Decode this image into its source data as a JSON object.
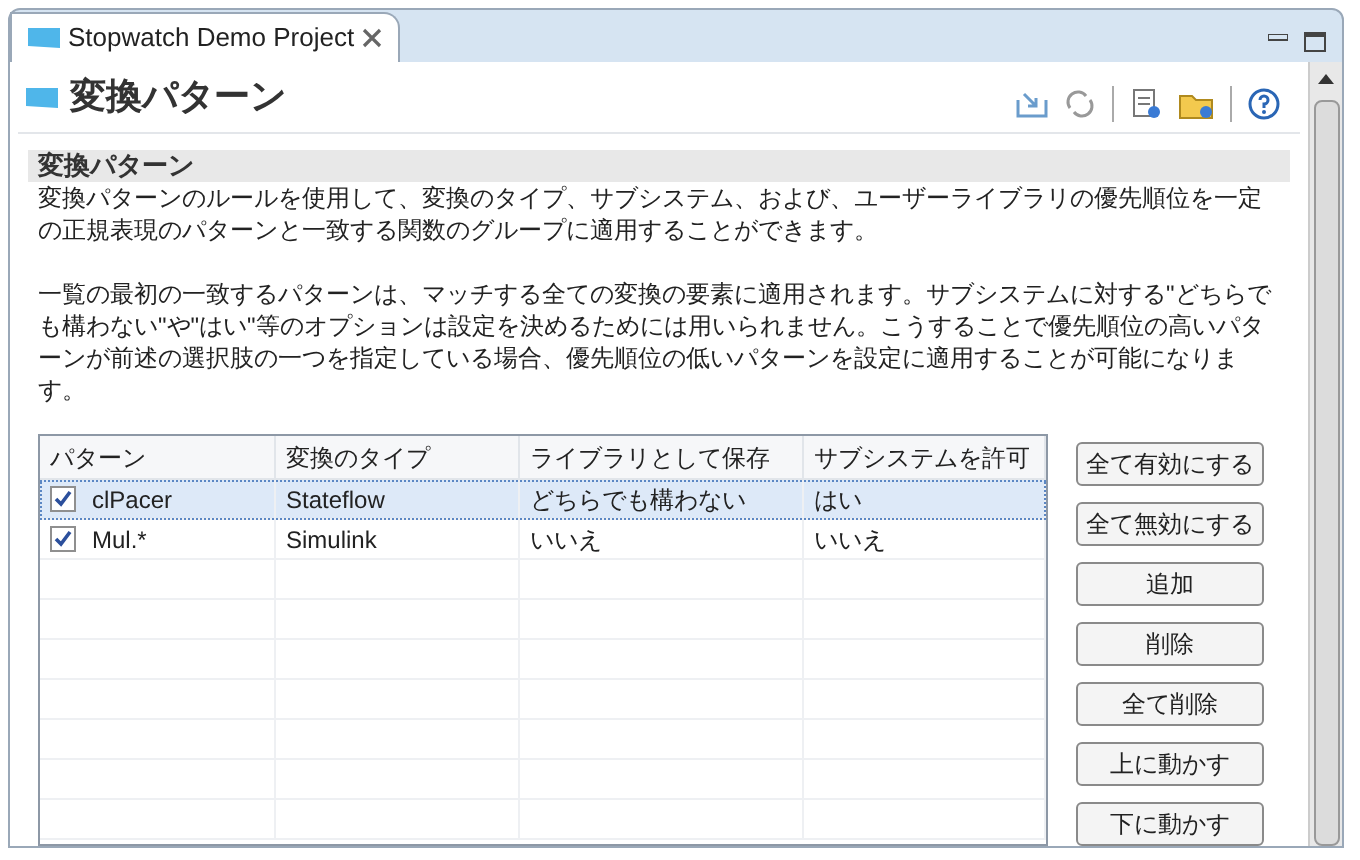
{
  "tab": {
    "label": "Stopwatch Demo Project",
    "selected": true
  },
  "page": {
    "title": "変換パターン"
  },
  "section": {
    "title": "変換パターン",
    "paragraphs": [
      "変換パターンのルールを使用して、変換のタイプ、サブシステム、および、ユーザーライブラリの優先順位を一定の正規表現のパターンと一致する関数のグループに適用することができます。",
      "一覧の最初の一致するパターンは、マッチする全ての変換の要素に適用されます。サブシステムに対する\"どちらでも構わない\"や\"はい\"等のオプションは設定を決めるためには用いられません。こうすることで優先順位の高いパターンが前述の選択肢の一つを指定している場合、優先順位の低いパターンを設定に適用することが可能になります。"
    ]
  },
  "table": {
    "columns": [
      "パターン",
      "変換のタイプ",
      "ライブラリとして保存",
      "サブシステムを許可"
    ],
    "rows": [
      {
        "checked": true,
        "selected": true,
        "cells": [
          "clPacer",
          "Stateflow",
          "どちらでも構わない",
          "はい"
        ]
      },
      {
        "checked": true,
        "selected": false,
        "cells": [
          "Mul.*",
          "Simulink",
          "いいえ",
          "いいえ"
        ]
      }
    ]
  },
  "buttons": [
    "全て有効にする",
    "全て無効にする",
    "追加",
    "削除",
    "全て削除",
    "上に動かす",
    "下に動かす"
  ]
}
